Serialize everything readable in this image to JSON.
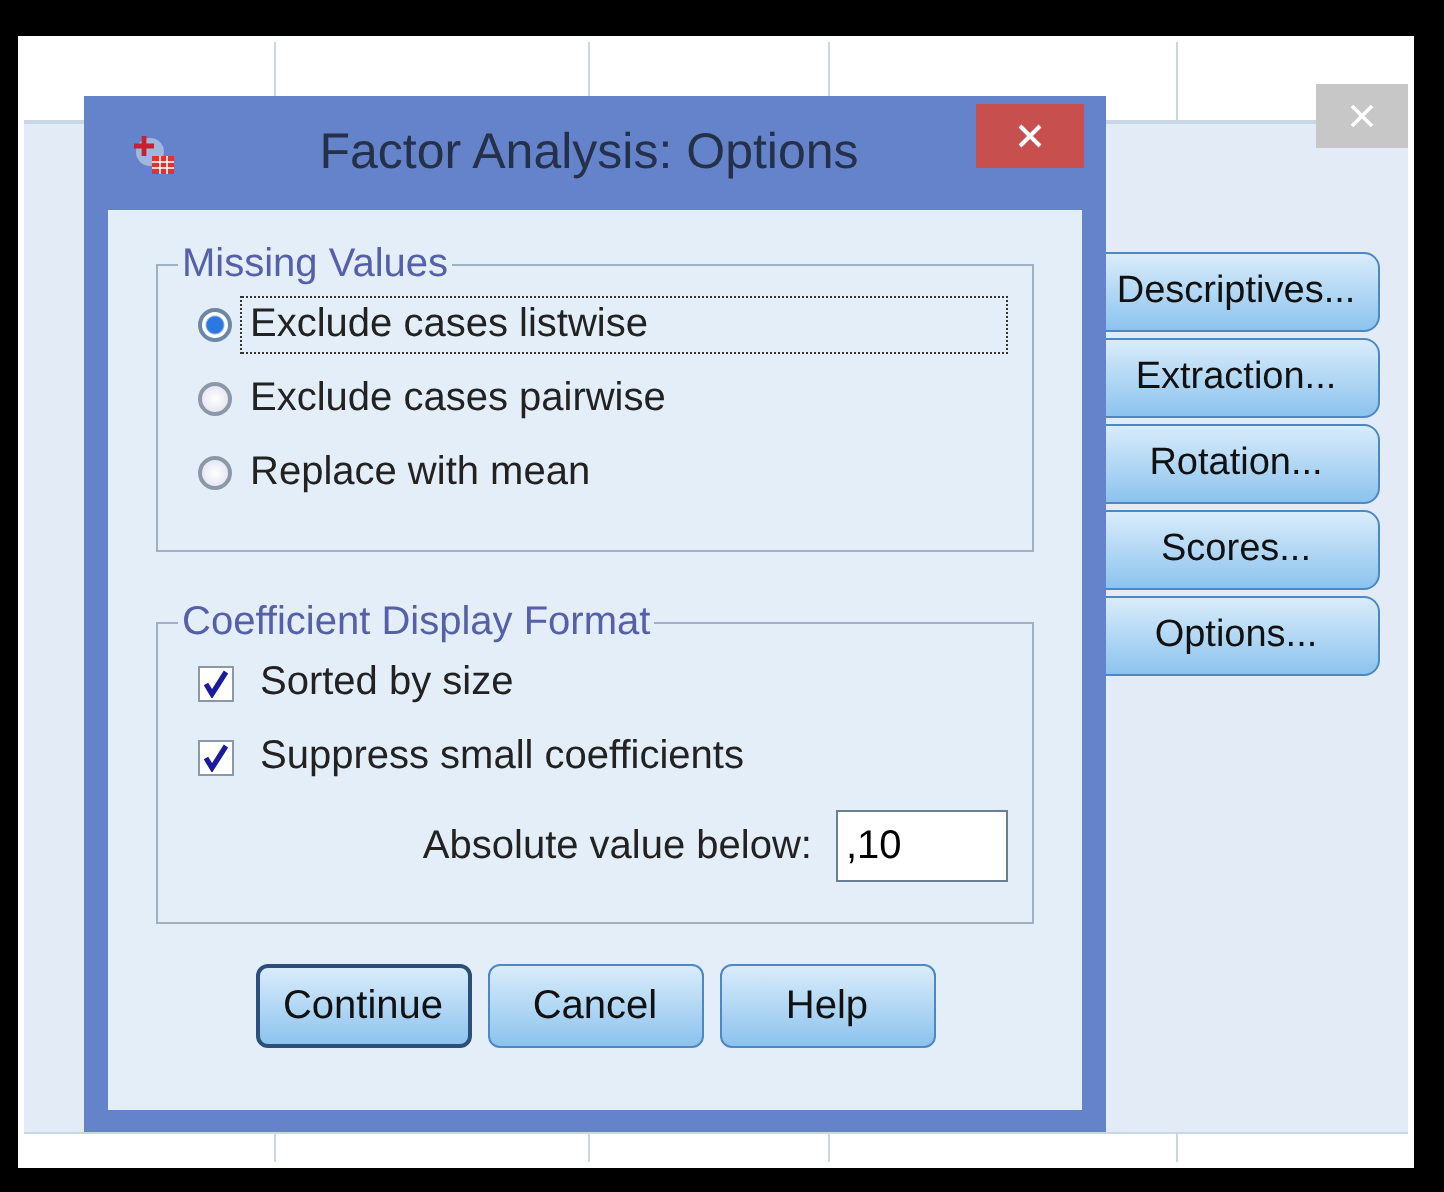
{
  "dialog": {
    "title": "Factor Analysis: Options",
    "groups": [
      {
        "kind": "radio",
        "title": "Missing Values",
        "items": [
          {
            "label": "Exclude cases listwise",
            "selected": true,
            "focused": true
          },
          {
            "label": "Exclude cases pairwise",
            "selected": false,
            "focused": false
          },
          {
            "label": "Replace with mean",
            "selected": false,
            "focused": false
          }
        ]
      },
      {
        "kind": "checkbox",
        "title": "Coefficient Display Format",
        "items": [
          {
            "label": "Sorted by size",
            "checked": true
          },
          {
            "label": "Suppress small coefficients",
            "checked": true
          }
        ],
        "field": {
          "label": "Absolute value below:",
          "value": ",10"
        }
      }
    ],
    "buttons": [
      {
        "label": "Continue",
        "default": true
      },
      {
        "label": "Cancel",
        "default": false
      },
      {
        "label": "Help",
        "default": false
      }
    ]
  },
  "parent_buttons": [
    {
      "label": "Descriptives..."
    },
    {
      "label": "Extraction..."
    },
    {
      "label": "Rotation..."
    },
    {
      "label": "Scores..."
    },
    {
      "label": "Options..."
    }
  ]
}
